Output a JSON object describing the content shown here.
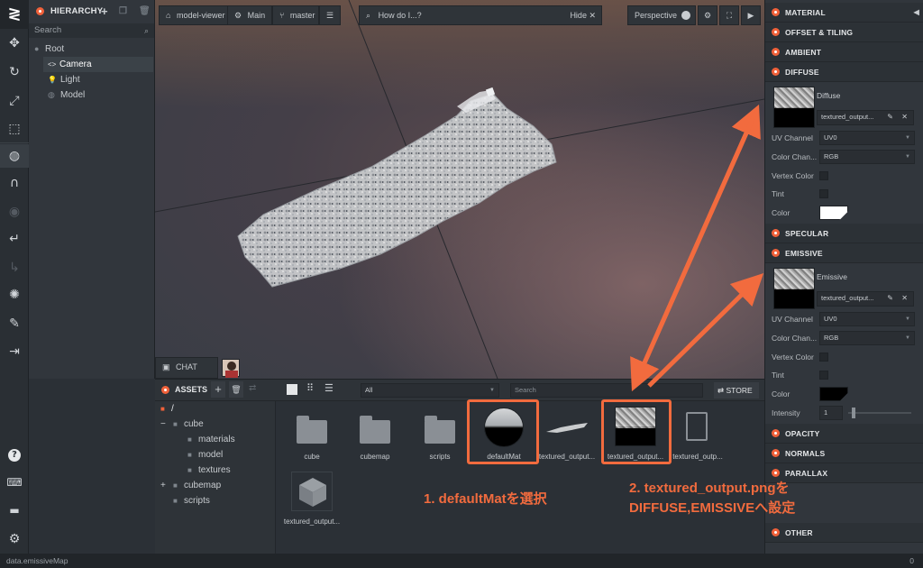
{
  "toolbar": {
    "logo": "≷",
    "icons": [
      "move-icon",
      "rotate-icon",
      "scale-icon",
      "resize-icon",
      "world-icon",
      "magnet-icon",
      "eye-icon",
      "undo-icon",
      "redo-icon",
      "light-icon",
      "edit-icon",
      "publish-icon",
      "help-icon",
      "keyboard-icon",
      "chat-icon",
      "settings-icon"
    ]
  },
  "hierarchy": {
    "title": "HIERARCHY",
    "search_placeholder": "Search",
    "items": [
      {
        "label": "Root"
      },
      {
        "label": "Camera"
      },
      {
        "label": "Light"
      },
      {
        "label": "Model"
      }
    ]
  },
  "viewport": {
    "project": "model-viewer",
    "scene": "Main",
    "branch": "master",
    "help_placeholder": "How do I...?",
    "help_hide": "Hide",
    "camera": "Perspective",
    "chat_label": "CHAT"
  },
  "assets": {
    "title": "ASSETS",
    "filter": "All",
    "search_placeholder": "Search",
    "store": "STORE",
    "tree": [
      {
        "label": "/"
      },
      {
        "label": "cube"
      },
      {
        "label": "materials"
      },
      {
        "label": "model"
      },
      {
        "label": "textures"
      },
      {
        "label": "cubemap"
      },
      {
        "label": "scripts"
      }
    ],
    "tiles": [
      {
        "label": "cube"
      },
      {
        "label": "cubemap"
      },
      {
        "label": "scripts"
      },
      {
        "label": "defaultMat"
      },
      {
        "label": "textured_output..."
      },
      {
        "label": "textured_output..."
      },
      {
        "label": "textured_outp..."
      },
      {
        "label": "textured_output..."
      }
    ]
  },
  "inspector": {
    "sections": {
      "material": "MATERIAL",
      "offset": "OFFSET & TILING",
      "ambient": "AMBIENT",
      "diffuse": "DIFFUSE",
      "specular": "SPECULAR",
      "emissive": "EMISSIVE",
      "opacity": "OPACITY",
      "normals": "NORMALS",
      "parallax": "PARALLAX",
      "other": "OTHER"
    },
    "diffuse": {
      "map_label": "Diffuse",
      "map_value": "textured_output...",
      "uv_label": "UV Channel",
      "uv_value": "UV0",
      "color_channel_label": "Color Chan...",
      "color_channel_value": "RGB",
      "vertex_color_label": "Vertex Color",
      "tint_label": "Tint",
      "color_label": "Color",
      "color_value": "#ffffff"
    },
    "emissive": {
      "map_label": "Emissive",
      "map_value": "textured_output...",
      "uv_label": "UV Channel",
      "uv_value": "UV0",
      "color_channel_label": "Color Chan...",
      "color_channel_value": "RGB",
      "vertex_color_label": "Vertex Color",
      "tint_label": "Tint",
      "color_label": "Color",
      "color_value": "#000000",
      "intensity_label": "Intensity",
      "intensity_value": "1"
    }
  },
  "status": {
    "text": "data.emissiveMap",
    "count": "0"
  },
  "annotations": {
    "step1": "1. defaultMatを選択",
    "step2_line1": "2. textured_output.pngを",
    "step2_line2": "DIFFUSE,EMISSIVEへ設定",
    "color": "#f26b3e"
  }
}
